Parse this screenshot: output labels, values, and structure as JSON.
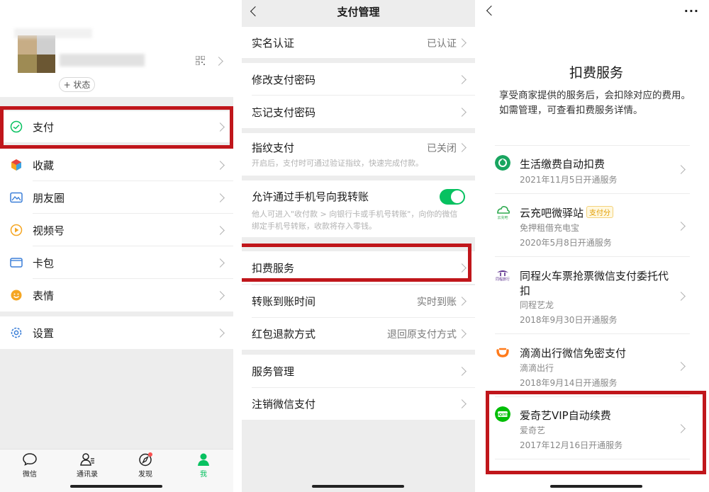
{
  "me": {
    "status_label": "+ 状态",
    "menu": [
      {
        "label": "支付",
        "icon": "pay-icon"
      },
      {
        "label": "收藏",
        "icon": "favorites-icon"
      },
      {
        "label": "朋友圈",
        "icon": "moments-icon"
      },
      {
        "label": "视频号",
        "icon": "channels-icon"
      },
      {
        "label": "卡包",
        "icon": "cards-icon"
      },
      {
        "label": "表情",
        "icon": "stickers-icon"
      },
      {
        "label": "设置",
        "icon": "settings-icon"
      }
    ],
    "tabs": [
      {
        "label": "微信",
        "icon": "chat-icon"
      },
      {
        "label": "通讯录",
        "icon": "contacts-icon"
      },
      {
        "label": "发现",
        "icon": "discover-icon"
      },
      {
        "label": "我",
        "icon": "me-icon"
      }
    ]
  },
  "payment": {
    "title": "支付管理",
    "real_name": {
      "label": "实名认证",
      "value": "已认证"
    },
    "change_pwd": "修改支付密码",
    "forgot_pwd": "忘记支付密码",
    "fingerprint": {
      "label": "指纹支付",
      "value": "已关闭",
      "hint": "开启后，支付时可通过验证指纹，快速完成付款。"
    },
    "phone_transfer": {
      "label": "允许通过手机号向我转账",
      "hint1": "他人可进入\"收付款 > 向银行卡或手机号转账\"，向你的微信",
      "hint2": "绑定手机号转账，收款将存入零钱。",
      "enabled": true
    },
    "deduction": "扣费服务",
    "arrival": {
      "label": "转账到账时间",
      "value": "实时到账"
    },
    "refund": {
      "label": "红包退款方式",
      "value": "退回原支付方式"
    },
    "service_mgmt": "服务管理",
    "cancel": "注销微信支付"
  },
  "deduction": {
    "title": "扣费服务",
    "desc": "享受商家提供的服务后，会扣除对应的费用。如需管理，可查看扣费服务详情。",
    "items": [
      {
        "name": "生活缴费自动扣费",
        "merchant": "",
        "date": "2021年11月5日开通服务",
        "color": "#19a560"
      },
      {
        "name": "云充吧微驿站",
        "badge": "支付分",
        "merchant": "免押租借充电宝",
        "date": "2020年5月8日开通服务",
        "color": "#2eaa4f"
      },
      {
        "name": "同程火车票抢票微信支付委托代",
        "name2": "扣",
        "merchant": "同程艺龙",
        "date": "2018年9月30日开通服务",
        "color": "#5a2d8c"
      },
      {
        "name": "滴滴出行微信免密支付",
        "merchant": "滴滴出行",
        "date": "2018年9月14日开通服务",
        "color": "#ff7a1a"
      },
      {
        "name": "爱奇艺VIP自动续费",
        "merchant": "爱奇艺",
        "date": "2017年12月16日开通服务",
        "color": "#00be06"
      }
    ]
  },
  "colors": {
    "accent": "#07c160",
    "highlight": "#c0161b"
  }
}
